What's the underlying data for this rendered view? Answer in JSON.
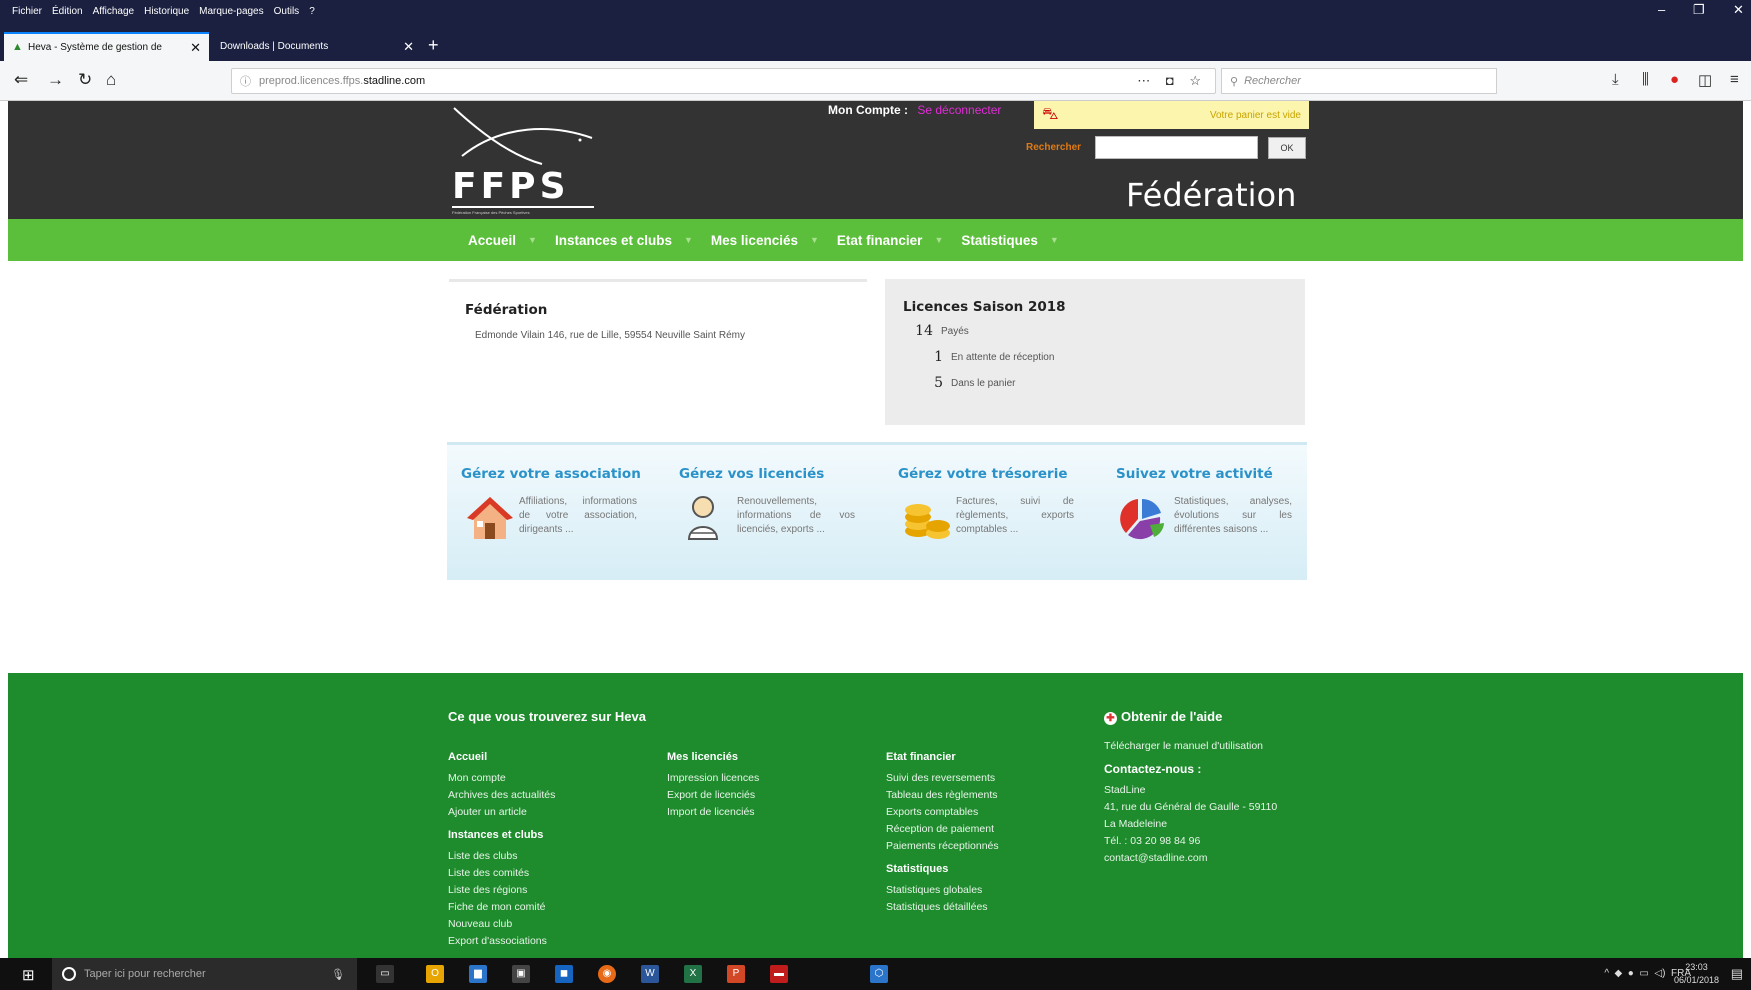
{
  "browser": {
    "menu": [
      "Fichier",
      "Édition",
      "Affichage",
      "Historique",
      "Marque-pages",
      "Outils",
      "?"
    ],
    "tabs": [
      {
        "title": "Heva - Système de gestion de",
        "active": true
      },
      {
        "title": "Downloads | Documents",
        "active": false
      }
    ],
    "url_prefix": "preprod.licences.ffps.",
    "url_domain": "stadline.com",
    "search_placeholder": "Rechercher"
  },
  "header": {
    "logo_text": "FFPS",
    "logo_subtext": "Fédération Française des Pêches Sportives",
    "account_label": "Mon Compte",
    "logout_label": "Se déconnecter",
    "cart_text": "Votre panier est vide",
    "search_label": "Rechercher",
    "search_button": "OK",
    "federation_title": "Fédération"
  },
  "nav": {
    "items": [
      "Accueil",
      "Instances et clubs",
      "Mes licenciés",
      "Etat financier",
      "Statistiques"
    ]
  },
  "federation_box": {
    "title": "Fédération",
    "address": "Edmonde Vilain 146, rue de Lille, 59554 Neuville Saint Rémy"
  },
  "licences_box": {
    "title": "Licences Saison 2018",
    "rows": [
      {
        "count": "14",
        "label": "Payés"
      },
      {
        "count": "1",
        "label": "En attente de réception"
      },
      {
        "count": "5",
        "label": "Dans le panier"
      }
    ]
  },
  "panels": [
    {
      "title": "Gérez votre association",
      "icon": "house-icon",
      "desc": "Affiliations, informations de votre association, dirigeants ..."
    },
    {
      "title": "Gérez vos licenciés",
      "icon": "person-icon",
      "desc": "Renouvellements, informations de vos licenciés, exports ..."
    },
    {
      "title": "Gérez votre trésorerie",
      "icon": "coins-icon",
      "desc": "Factures, suivi de règlements, exports comptables ..."
    },
    {
      "title": "Suivez votre activité",
      "icon": "pie-chart-icon",
      "desc": "Statistiques, analyses, évolutions sur les différentes saisons ..."
    }
  ],
  "footer": {
    "heading": "Ce que vous trouverez sur Heva",
    "col1": {
      "sections": [
        {
          "title": "Accueil",
          "links": [
            "Mon compte",
            "Archives des actualités",
            "Ajouter un article"
          ]
        },
        {
          "title": "Instances et clubs",
          "links": [
            "Liste des clubs",
            "Liste des comités",
            "Liste des régions",
            "Fiche de mon comité",
            "Nouveau club",
            "Export d'associations"
          ]
        }
      ]
    },
    "col2": {
      "sections": [
        {
          "title": "Mes licenciés",
          "links": [
            "Impression licences",
            "Export de licenciés",
            "Import de licenciés"
          ]
        }
      ]
    },
    "col3": {
      "sections": [
        {
          "title": "Etat financier",
          "links": [
            "Suivi des reversements",
            "Tableau des règlements",
            "Exports comptables",
            "Réception de paiement",
            "Paiements réceptionnés"
          ]
        },
        {
          "title": "Statistiques",
          "links": [
            "Statistiques globales",
            "Statistiques détaillées"
          ]
        }
      ]
    },
    "help": {
      "heading": "Obtenir de l'aide",
      "manual_link": "Télécharger le manuel d'utilisation",
      "contact_heading": "Contactez-nous :",
      "lines": [
        "StadLine",
        "41, rue du Général de Gaulle - 59110",
        "La Madeleine",
        "Tél. : 03 20 98 84 96",
        "contact@stadline.com"
      ]
    }
  },
  "taskbar": {
    "search_placeholder": "Taper ici pour rechercher",
    "lang": "FRA",
    "time": "23:03",
    "date": "06/01/2018"
  }
}
